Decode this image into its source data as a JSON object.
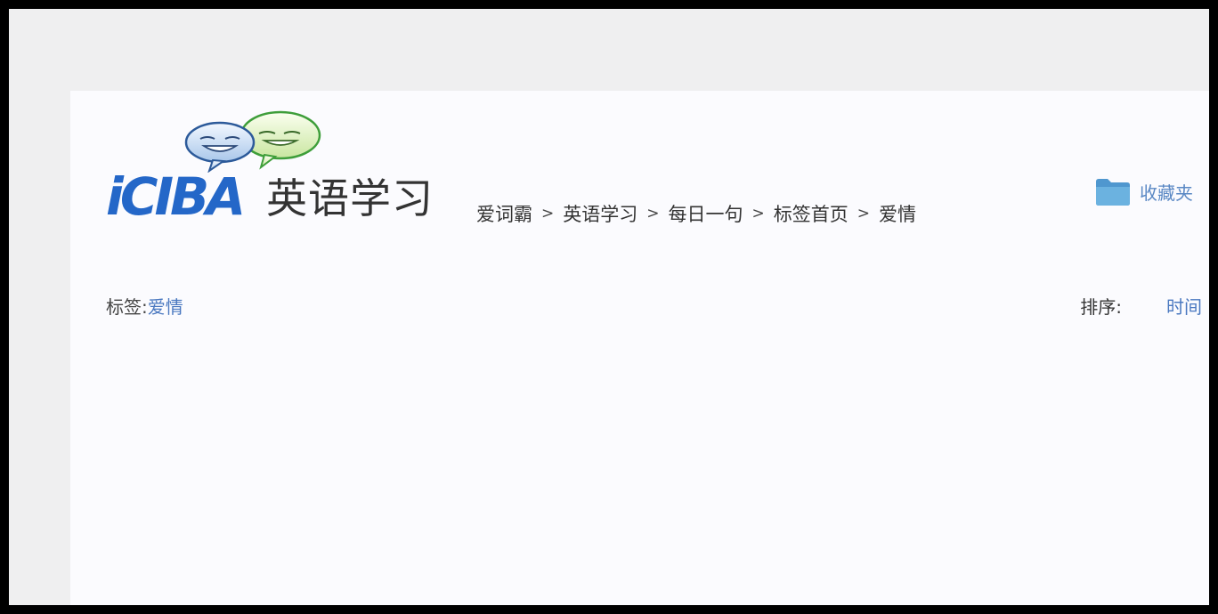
{
  "logo": {
    "wordmark": "iCIBA",
    "subtitle": "英语学习"
  },
  "breadcrumb": {
    "items": [
      "爱词霸",
      "英语学习",
      "每日一句",
      "标签首页",
      "爱情"
    ],
    "separator": ">"
  },
  "favorites": {
    "label": "收藏夹",
    "icon": "folder-icon"
  },
  "tag": {
    "label": "标签:",
    "value": "爱情"
  },
  "sort": {
    "label": "排序:",
    "value": "时间"
  },
  "colors": {
    "brand_blue": "#2467c8",
    "link_blue": "#4a78c0",
    "folder_blue": "#5ba3d6"
  }
}
